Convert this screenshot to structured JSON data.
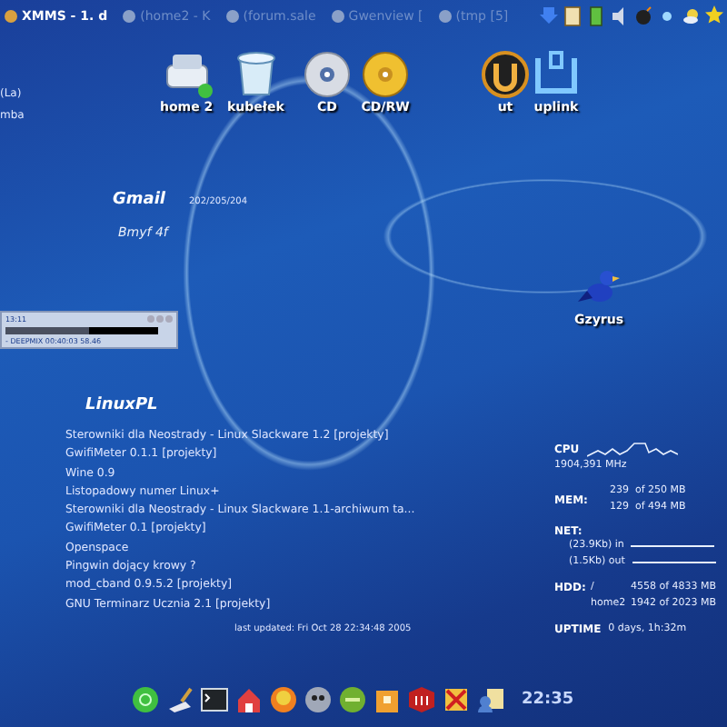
{
  "taskbar": {
    "tasks": [
      {
        "label": "XMMS - 1. d",
        "selected": true
      },
      {
        "label": "(home2 - K",
        "selected": false
      },
      {
        "label": "(forum.sale",
        "selected": false
      },
      {
        "label": "Gwenview [",
        "selected": false
      },
      {
        "label": "(tmp [5]",
        "selected": false
      }
    ]
  },
  "desktop_edge_texts": [
    "(La)",
    "mba"
  ],
  "desktop_icons": [
    {
      "label": "home 2"
    },
    {
      "label": "kubełek"
    },
    {
      "label": "CD"
    },
    {
      "label": "CD/RW"
    },
    {
      "label": "ut"
    },
    {
      "label": "uplink"
    }
  ],
  "mail_widget": {
    "title": "Gmail",
    "count": "202/205/204",
    "status": "Bmyf 4f"
  },
  "xmms_player": {
    "time": "13:11",
    "level": 0.55,
    "track": "- DEEPMIX 00:40:03 58.46"
  },
  "news_widget": {
    "title": "LinuxPL",
    "items": [
      "Sterowniki dla Neostrady - Linux Slackware 1.2 [projekty]",
      "GwifiMeter 0.1.1 [projekty]",
      "Wine 0.9",
      "Listopadowy numer Linux+",
      "Sterowniki dla Neostrady - Linux Slackware 1.1-archiwum ta...",
      "GwifiMeter 0.1 [projekty]",
      "Openspace",
      "Pingwin dojący krowy ?",
      "mod_cband 0.9.5.2 [projekty]",
      "GNU Terminarz Ucznia 2.1 [projekty]"
    ],
    "updated": "last updated: Fri Oct 28 22:34:48 2005"
  },
  "bird_icon": {
    "label": "Gzyrus"
  },
  "system_monitor": {
    "cpu": {
      "label": "CPU",
      "frequency": "1904,391 MHz"
    },
    "memory": {
      "label": "MEM:",
      "rows": [
        "239  of 250 MB",
        "129  of 494 MB"
      ]
    },
    "network": {
      "label": "NET:",
      "rows": [
        "(23.9Kb) in",
        "(1.5Kb) out"
      ]
    },
    "disks": {
      "label": "HDD:",
      "rows": [
        {
          "mount": "/",
          "usage": "4558 of 4833 MB"
        },
        {
          "mount": "home2",
          "usage": "1942 of 2023 MB"
        }
      ]
    },
    "uptime": {
      "label": "UPTIME",
      "value": "0 days, 1h:32m"
    }
  },
  "dock": {
    "clock": "22:35"
  }
}
